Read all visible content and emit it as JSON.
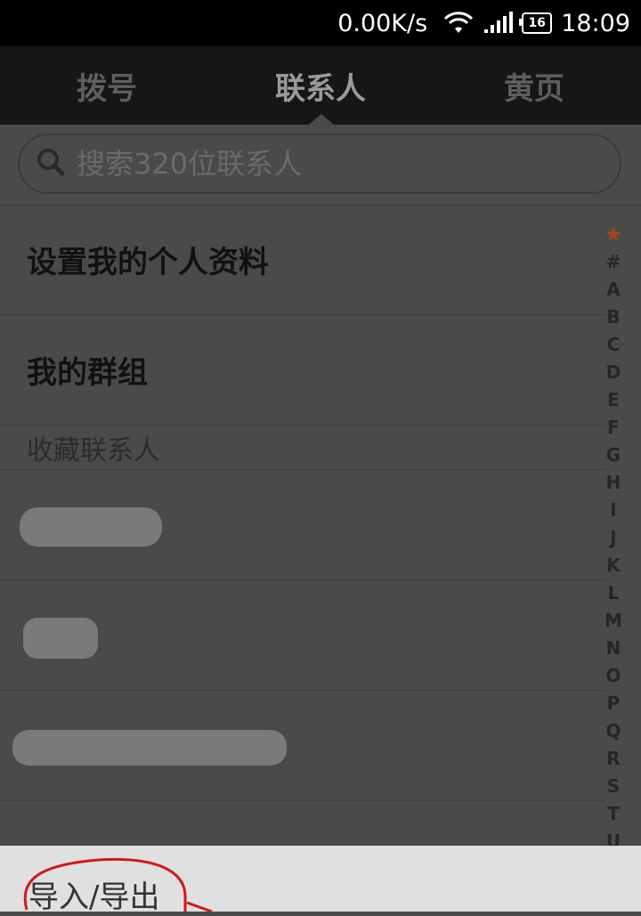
{
  "status_bar": {
    "net_speed": "0.00K/s",
    "battery": "16",
    "time": "18:09",
    "icons": [
      "wifi-icon",
      "signal-icon",
      "battery-icon"
    ]
  },
  "tabs": [
    {
      "label": "拨号",
      "active": false
    },
    {
      "label": "联系人",
      "active": true
    },
    {
      "label": "黄页",
      "active": false
    }
  ],
  "search": {
    "placeholder": "搜索320位联系人"
  },
  "list": {
    "profile_label": "设置我的个人资料",
    "groups_label": "我的群组",
    "favorites_header": "收藏联系人"
  },
  "alphabet_index": [
    "★",
    "#",
    "A",
    "B",
    "C",
    "D",
    "E",
    "F",
    "G",
    "H",
    "I",
    "J",
    "K",
    "L",
    "M",
    "N",
    "O",
    "P",
    "Q",
    "R",
    "S",
    "T",
    "U"
  ],
  "bottom_menu": {
    "import_export": "导入/导出"
  },
  "colors": {
    "overlay_gray": "#4a4a4a",
    "tab_bar": "#161616",
    "star_accent": "#a24418",
    "annotation_red": "#d11a1a"
  }
}
